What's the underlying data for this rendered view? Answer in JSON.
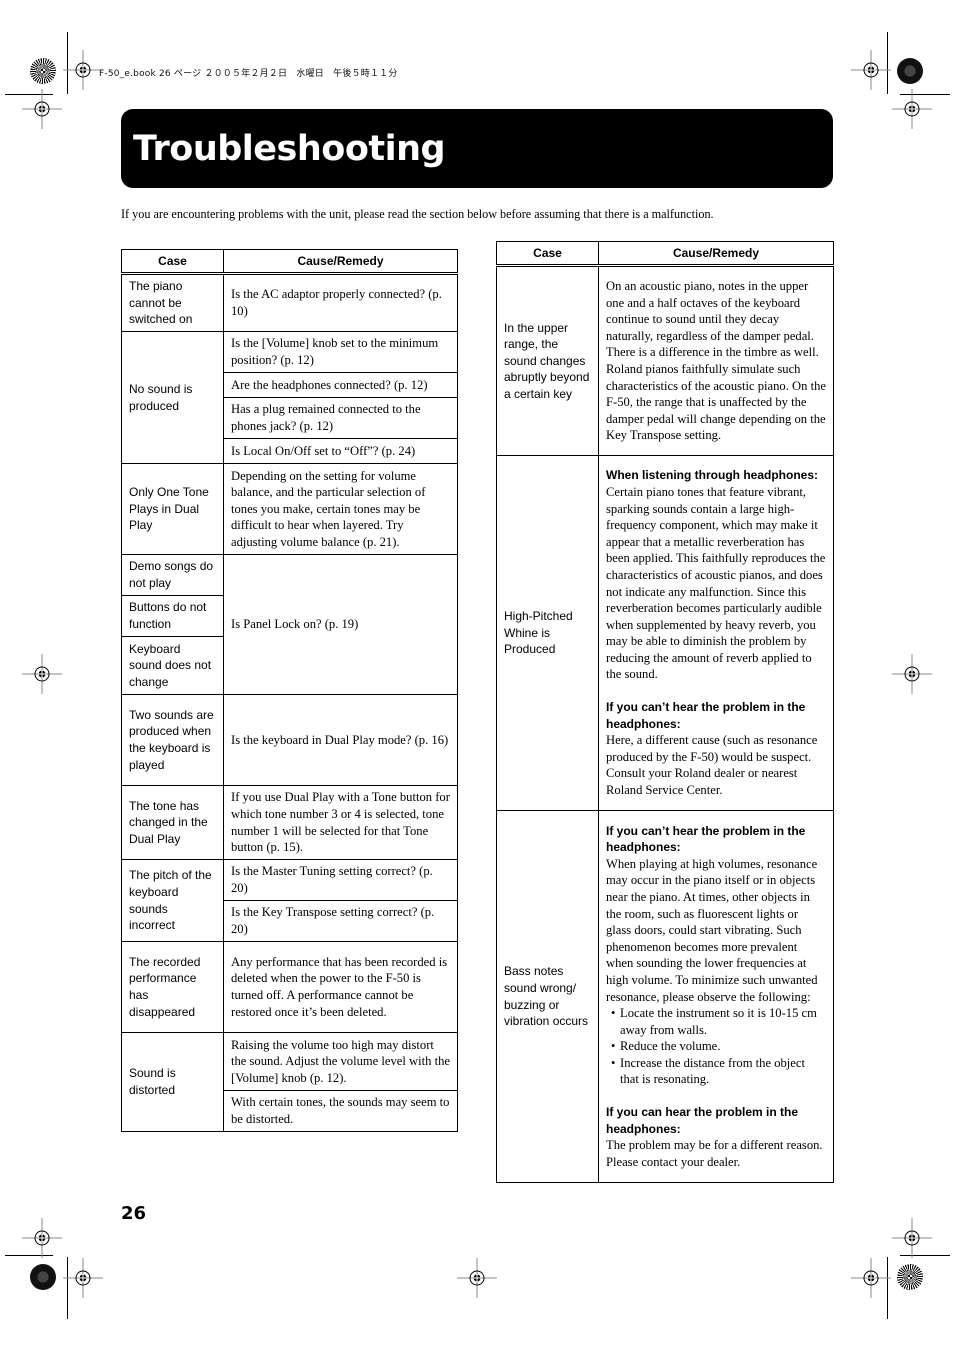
{
  "print_header": {
    "job_info": "F-50_e.book  26 ページ  ２００５年２月２日　水曜日　午後５時１１分"
  },
  "title": "Troubleshooting",
  "intro": "If you are encountering problems with the unit, please read the section below before assuming that there is a malfunction.",
  "left_table": {
    "headers": {
      "case": "Case",
      "remedy": "Cause/Remedy"
    },
    "rows": [
      {
        "case": "The piano cannot be switched on",
        "remedies": [
          "Is the AC adaptor properly connected? (p. 10)"
        ]
      },
      {
        "case": "No sound is produced",
        "remedies": [
          "Is the [Volume] knob set to the minimum position? (p. 12)",
          "Are the headphones connected? (p. 12)",
          "Has a plug remained connected to the phones jack? (p. 12)",
          "Is Local On/Off set to “Off”? (p. 24)"
        ]
      },
      {
        "case": "Only One Tone Plays in Dual Play",
        "remedies": [
          "Depending on the setting for volume balance, and the particular selection of tones you make, certain tones may be difficult to hear when layered. Try adjusting volume balance (p. 21)."
        ]
      },
      {
        "cases": [
          "Demo songs do not play",
          "Buttons do not function",
          "Keyboard sound does not change"
        ],
        "remedies": [
          "Is Panel Lock on? (p. 19)"
        ]
      },
      {
        "case": "Two sounds are produced when the keyboard is played",
        "remedies": [
          "Is the keyboard in Dual Play mode? (p. 16)"
        ]
      },
      {
        "case": "The tone has changed in the Dual Play",
        "remedies": [
          "If you use Dual Play with a Tone button for which tone number 3 or 4 is selected, tone number 1 will be selected for that Tone button (p. 15)."
        ]
      },
      {
        "case": "The pitch of the keyboard sounds incorrect",
        "remedies": [
          "Is the Master Tuning setting correct? (p. 20)",
          "Is the Key Transpose setting correct? (p. 20)"
        ]
      },
      {
        "case": "The recorded performance has disappeared",
        "remedies": [
          "Any performance that has been recorded is deleted when the power to the F-50 is turned off. A performance cannot be restored once it’s been deleted."
        ]
      },
      {
        "case": "Sound is distorted",
        "remedies": [
          "Raising the volume too high may distort the sound. Adjust the volume level with the [Volume] knob (p. 12).",
          "With certain tones, the sounds may seem to be distorted."
        ]
      }
    ]
  },
  "right_table": {
    "headers": {
      "case": "Case",
      "remedy": "Cause/Remedy"
    },
    "rows": [
      {
        "case": "In the upper range, the sound changes abruptly beyond a certain key",
        "remedy_text": "On an acoustic piano, notes in the upper one and a half octaves of the keyboard continue to sound until they decay naturally, regardless of the damper pedal. There is a difference in the timbre as well. Roland pianos faithfully simulate such characteristics of the acoustic piano. On the F-50, the range that is unaffected by the damper pedal will change depending on the Key Transpose setting."
      },
      {
        "case": "High-Pitched Whine is Produced",
        "sections": [
          {
            "heading": "When listening through headphones:",
            "text": "Certain piano tones that feature vibrant, sparking sounds contain a large high-frequency component, which may make it appear that a metallic reverberation has been applied. This faithfully reproduces the characteristics of acoustic pianos, and does not indicate any malfunction. Since this reverberation becomes particularly audible when supplemented by heavy reverb, you may be able to diminish the problem by reducing the amount of reverb applied to the sound."
          },
          {
            "heading": "If you can’t hear the problem in the headphones:",
            "text": "Here, a different cause (such as resonance produced by the F-50) would be suspect. Consult your Roland dealer or nearest Roland Service Center."
          }
        ]
      },
      {
        "case": "Bass notes sound wrong/ buzzing or vibration occurs",
        "sections": [
          {
            "heading": "If you can’t hear the problem in the headphones:",
            "text": "When playing at high volumes, resonance may occur in the piano itself or in objects near the piano. At times, other objects in the room, such as fluorescent lights or glass doors, could start vibrating. Such phenomenon becomes more prevalent when sounding the lower frequencies at high volume. To minimize such unwanted resonance, please observe the following:",
            "bullets": [
              "Locate the instrument so it is 10-15 cm away from walls.",
              "Reduce the volume.",
              "Increase the distance from the object that is resonating."
            ]
          },
          {
            "heading": "If you can hear the problem in the headphones:",
            "text": "The problem may be for a different reason. Please contact your dealer."
          }
        ]
      }
    ]
  },
  "page_number": "26"
}
